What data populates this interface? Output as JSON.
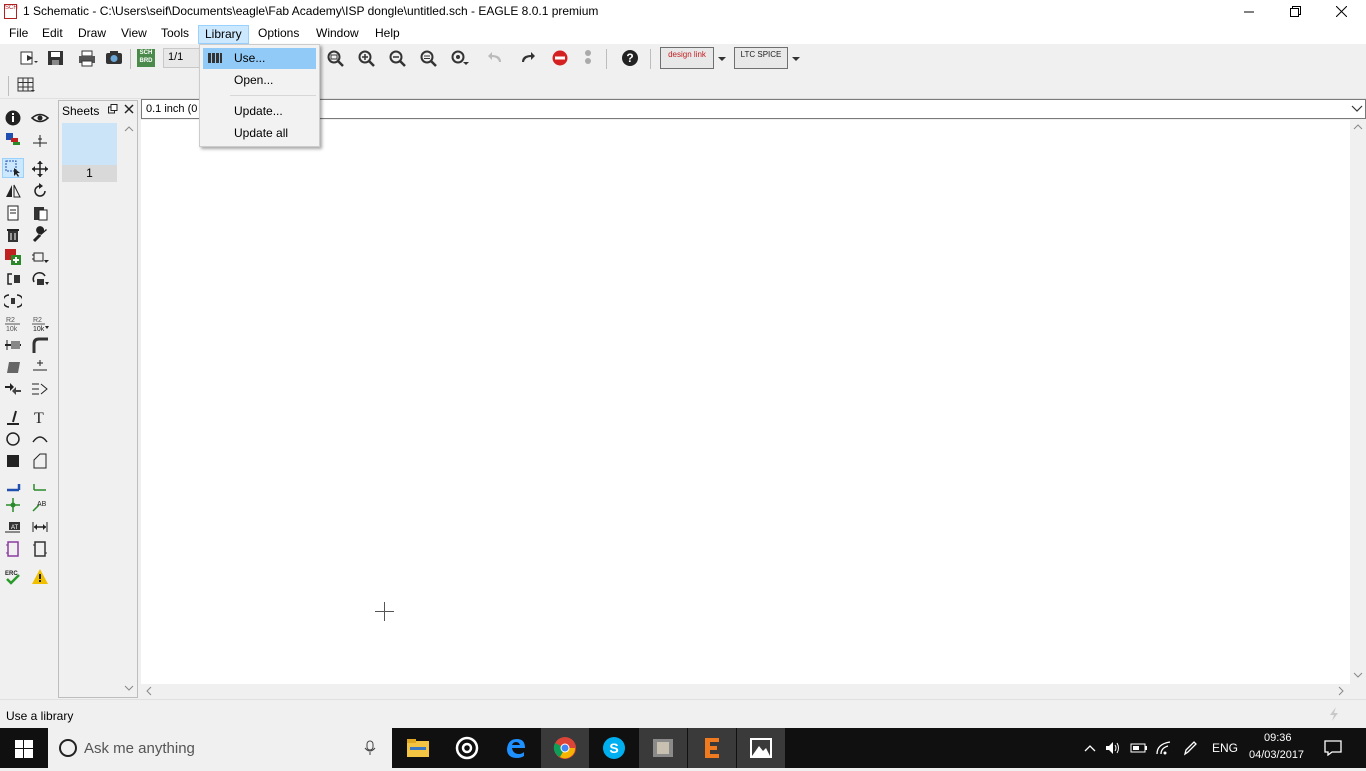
{
  "window": {
    "title": "1 Schematic - C:\\Users\\seif\\Documents\\eagle\\Fab Academy\\ISP dongle\\untitled.sch - EAGLE 8.0.1 premium",
    "app_icon_text": "SCH"
  },
  "menubar": {
    "items": [
      "File",
      "Edit",
      "Draw",
      "View",
      "Tools",
      "Library",
      "Options",
      "Window",
      "Help"
    ],
    "active": "Library"
  },
  "toolbar": {
    "page_combo": "1/1",
    "sch_brd_label": "SCH BRD",
    "designlink_label": "design link",
    "ltspice_label": "LTC SPICE"
  },
  "library_menu": {
    "items": [
      {
        "label": "Use...",
        "highlighted": true
      },
      {
        "label": "Open..."
      },
      {
        "label": "Update..."
      },
      {
        "label": "Update all"
      }
    ]
  },
  "sheets": {
    "title": "Sheets",
    "thumb_label": "1"
  },
  "coord_bar": {
    "text": "0.1 inch (0"
  },
  "statusbar": {
    "text": "Use a library"
  },
  "taskbar": {
    "search_placeholder": "Ask me anything",
    "language": "ENG",
    "time": "09:36",
    "date": "04/03/2017"
  },
  "colors": {
    "menu_active_bg": "#cce8ff",
    "menu_highlight": "#91c9f7",
    "sheet_thumb": "#cce4f7",
    "taskbar_bg": "#101010"
  }
}
